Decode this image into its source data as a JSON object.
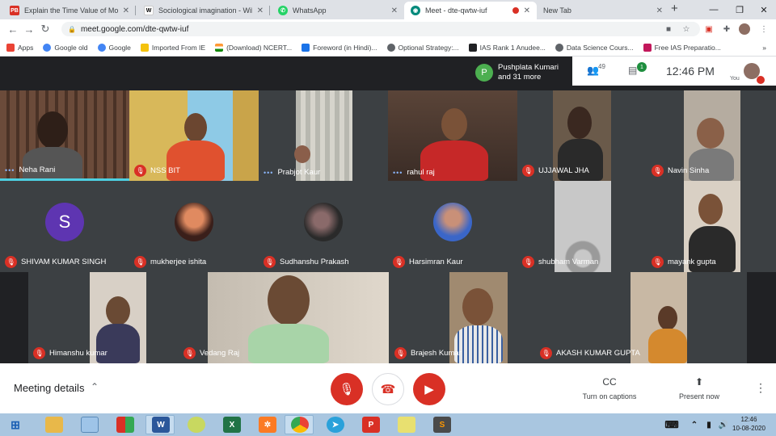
{
  "browser": {
    "tabs": [
      {
        "label": "Explain the Time Value of Mone",
        "favicon": "pb-icon",
        "favcolor": "#d93025",
        "favtext": "PB"
      },
      {
        "label": "Sociological imagination - Wiki",
        "favicon": "wikipedia-icon",
        "favcolor": "#ffffff",
        "favtext": "W"
      },
      {
        "label": "WhatsApp",
        "favicon": "whatsapp-icon",
        "favcolor": "#25d366",
        "favtext": "✆"
      },
      {
        "label": "Meet - dte-qwtw-iuf",
        "favicon": "meet-icon",
        "favcolor": "#00897b",
        "favtext": "◉",
        "active": true
      },
      {
        "label": "New Tab",
        "favicon": "",
        "favcolor": "",
        "favtext": ""
      }
    ],
    "new_tab_glyph": "+",
    "url": "meet.google.com/dte-qwtw-iuf"
  },
  "bookmarks": [
    {
      "label": "Apps",
      "color": "#ea4335"
    },
    {
      "label": "Google old",
      "color": "#4285f4"
    },
    {
      "label": "Google",
      "color": "#4285f4"
    },
    {
      "label": "Imported From IE",
      "color": "#f4c20d"
    },
    {
      "label": "(Download) NCERT...",
      "color": "#ff9933"
    },
    {
      "label": "Foreword (in Hindi)...",
      "color": "#1a73e8"
    },
    {
      "label": "Optional Strategy:...",
      "color": "#5f6368"
    },
    {
      "label": "IAS Rank 1 Anudee...",
      "color": "#202124"
    },
    {
      "label": "Data Science Cours...",
      "color": "#5f6368"
    },
    {
      "label": "Free IAS Preparatio...",
      "color": "#c2185b"
    }
  ],
  "bookmarks_more": "»",
  "meet": {
    "presenter_initial": "P",
    "presenter_name": "Pushplata Kumari",
    "presenter_more": "and 31 more",
    "people_count": "49",
    "chat_badge": "1",
    "time": "12:46  PM",
    "you_label": "You"
  },
  "participants": [
    {
      "name": "Neha Rani",
      "status": "speaking"
    },
    {
      "name": "NSS BIT",
      "status": "muted"
    },
    {
      "name": "Prabjot Kaur",
      "status": "speaking"
    },
    {
      "name": "rahul raj",
      "status": "speaking"
    },
    {
      "name": "UJJAWAL JHA",
      "status": "muted"
    },
    {
      "name": "Navin Sinha",
      "status": "muted"
    },
    {
      "name": "SHIVAM KUMAR SINGH",
      "status": "muted",
      "avatar_letter": "S"
    },
    {
      "name": "mukherjee ishita",
      "status": "muted"
    },
    {
      "name": "Sudhanshu Prakash",
      "status": "muted"
    },
    {
      "name": "Harsimran Kaur",
      "status": "muted"
    },
    {
      "name": "shubham Varman",
      "status": "muted"
    },
    {
      "name": "mayank gupta",
      "status": "muted"
    },
    {
      "name": "Himanshu kumar",
      "status": "muted"
    },
    {
      "name": "Vedang Raj",
      "status": "muted"
    },
    {
      "name": "Brajesh Kumar",
      "status": "muted"
    },
    {
      "name": "AKASH KUMAR GUPTA",
      "status": "muted"
    }
  ],
  "controls": {
    "meeting_details": "Meeting details",
    "captions_label": "Turn on captions",
    "present_label": "Present now",
    "cc_glyph": "CC"
  },
  "taskbar": {
    "time": "12:46",
    "date": "10-08-2020",
    "apps": [
      "windows-start-icon",
      "file-explorer-icon",
      "notepad-icon",
      "paint-icon",
      "word-icon",
      "pidgin-icon",
      "excel-icon",
      "xampp-icon",
      "chrome-icon",
      "telegram-icon",
      "psiphon-icon",
      "sticky-notes-icon",
      "sublime-icon"
    ]
  }
}
